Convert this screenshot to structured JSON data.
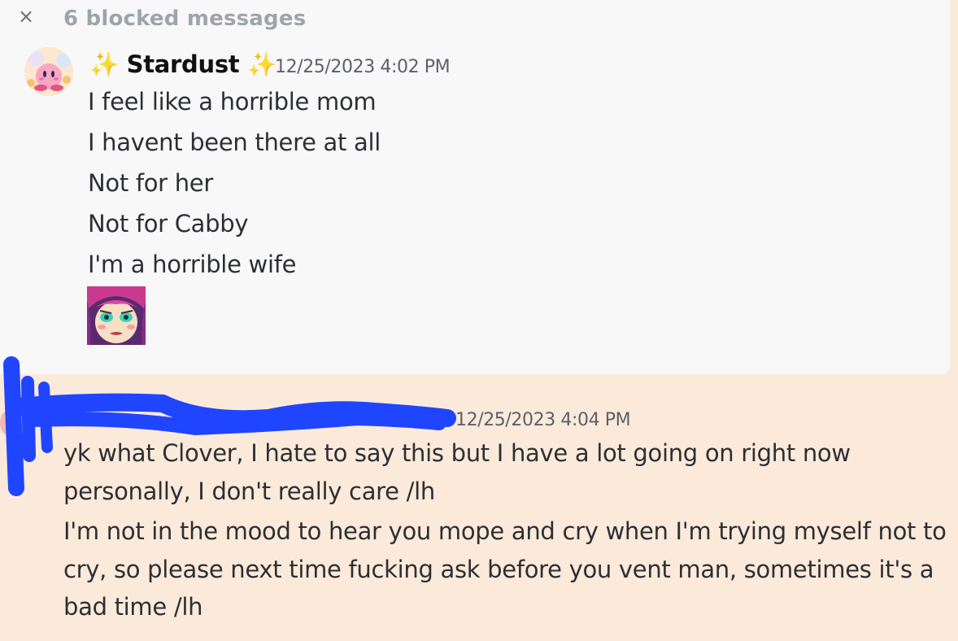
{
  "blocked": {
    "close_icon": "×",
    "label": "6 blocked messages"
  },
  "message_group_1": {
    "username_prefix": "✨",
    "username": "Stardust",
    "username_suffix": "✨",
    "timestamp": "12/25/2023 4:02 PM",
    "lines": [
      "I feel like a horrible mom",
      "I havent been there at all",
      "Not for her",
      "Not for Cabby",
      "I'm a horrible wife"
    ],
    "sticker": "crying-anime-girl-sticker"
  },
  "message_group_2": {
    "timestamp": "12/25/2023 4:04 PM",
    "lines": [
      "yk what Clover, I hate to say this but I have a lot going on right now",
      "personally, I don't really care /lh",
      "I'm not in the mood to hear you mope and cry when I'm trying myself not to",
      "cry, so please next time fucking ask before you vent man, sometimes it's a",
      "bad time /lh"
    ]
  },
  "colors": {
    "card_background": "#f8f8f9",
    "highlight_background": "#fbeada",
    "redaction_scribble": "#1f45ff",
    "text": "#2d2f33",
    "muted": "#9ea4ac"
  }
}
